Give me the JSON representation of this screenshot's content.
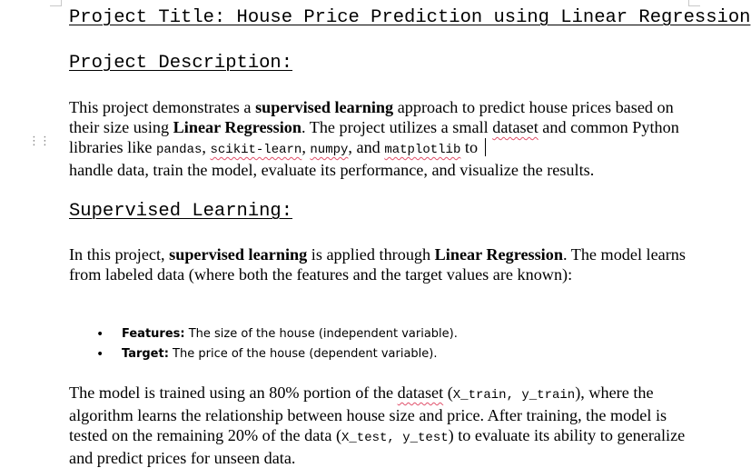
{
  "title": "Project Title: House Price Prediction using Linear Regression",
  "description_heading": "Project Description:",
  "description": {
    "t1": "This project demonstrates a ",
    "b1": "supervised learning",
    "t2": " approach to predict house prices based on their size using ",
    "b2": "Linear Regression",
    "t3": ". The project utilizes a small ",
    "w_dataset": "dataset",
    "t4": " and common Python libraries like ",
    "c_pandas": "pandas",
    "s1": ", ",
    "c_sklearn": "scikit-learn",
    "s2": ", ",
    "c_numpy": "numpy",
    "s3": ", and ",
    "c_matplotlib": "matplotlib",
    "s4": " to ",
    "t5": "handle data, train the model, evaluate its performance, and visualize the results."
  },
  "supervised_heading": "Supervised Learning:",
  "supervised": {
    "t1": "In this project, ",
    "b1": "supervised learning",
    "t2": " is applied through ",
    "b2": "Linear Regression",
    "t3": ". The model learns from labeled data (where both the features and the target values are known):"
  },
  "bullets": [
    {
      "label": "Features:",
      "text": " The size of the house (independent variable)."
    },
    {
      "label": "Target:",
      "text": " The price of the house (dependent variable)."
    }
  ],
  "training": {
    "t1": "The model is trained using an 80% portion of the ",
    "w_dataset": "dataset",
    "t2": " (",
    "c1": "X_train, y_train",
    "t3": "), where the algorithm learns the relationship between house size and price. After training, the model is tested on the remaining 20% of the data (",
    "c2": "X_test, y_test",
    "t4": ") to evaluate its ability to generalize and predict prices for unseen data."
  }
}
